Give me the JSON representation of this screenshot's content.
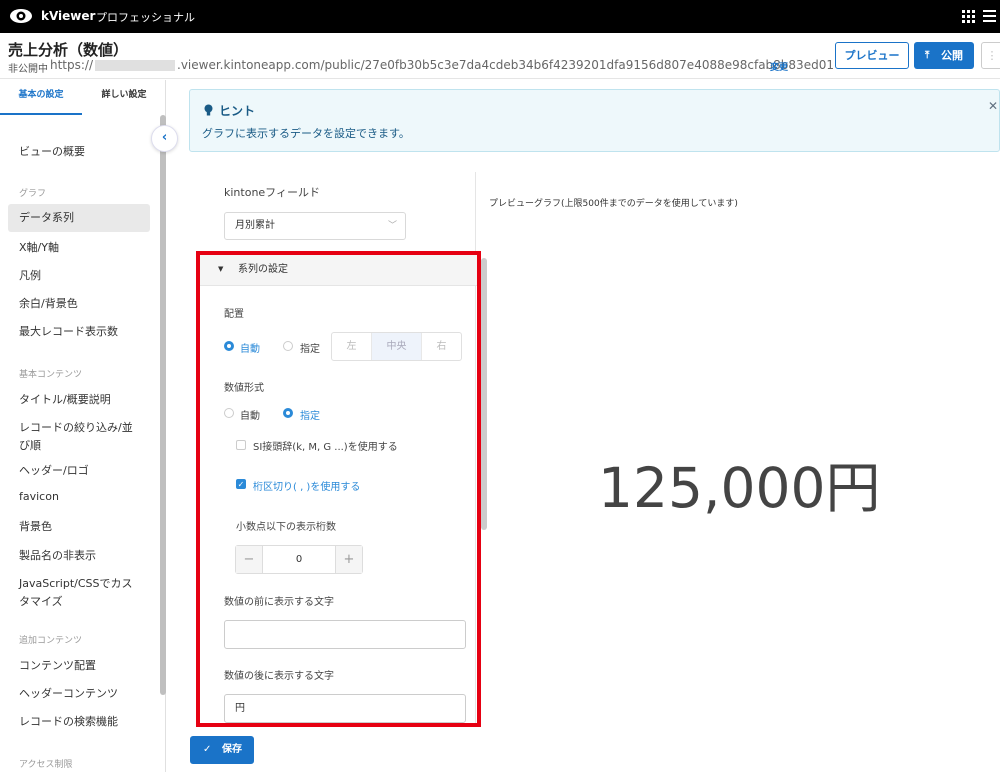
{
  "app": {
    "brand": "kViewer",
    "edition": "プロフェッショナル"
  },
  "header": {
    "title": "売上分析（数値）",
    "status": "非公開中",
    "url_prefix": "https://",
    "url_suffix": ".viewer.kintoneapp.com/public/27e0fb30b5c3e7da4cdeb34b6f4239201dfa9156d807e4088e98cfab8b83ed01",
    "change_label": "変更",
    "preview_button": "プレビュー",
    "publish_button": "公開"
  },
  "sidebar": {
    "tabs": [
      "基本の設定",
      "詳しい設定"
    ],
    "items": {
      "overview": "ビューの概要",
      "graph_section": "グラフ",
      "data_series": "データ系列",
      "axis": "X軸/Y軸",
      "legend": "凡例",
      "margin_bg": "余白/背景色",
      "max_records": "最大レコード表示数",
      "basic_content_section": "基本コンテンツ",
      "title_desc": "タイトル/概要説明",
      "filter_sort_1": "レコードの絞り込み/並",
      "filter_sort_2": "び順",
      "header_logo": "ヘッダー/ロゴ",
      "favicon": "favicon",
      "bg_color": "背景色",
      "hide_product": "製品名の非表示",
      "js_css_1": "JavaScript/CSSでカス",
      "js_css_2": "タマイズ",
      "extra_section": "追加コンテンツ",
      "content_layout": "コンテンツ配置",
      "header_content": "ヘッダーコンテンツ",
      "record_search": "レコードの検索機能",
      "access_section": "アクセス制限"
    }
  },
  "hint": {
    "title": "ヒント",
    "description": "グラフに表示するデータを設定できます。"
  },
  "form": {
    "kintone_field_label": "kintoneフィールド",
    "kintone_field_value": "月別累計",
    "series_settings": "系列の設定",
    "placement_label": "配置",
    "placement_auto": "自動",
    "placement_manual": "指定",
    "align_left": "左",
    "align_center": "中央",
    "align_right": "右",
    "number_format_label": "数値形式",
    "format_auto": "自動",
    "format_manual": "指定",
    "si_prefix": "SI接頭辞(k, M, G ...)を使用する",
    "thousands_sep": "桁区切り( , )を使用する",
    "decimal_label": "小数点以下の表示桁数",
    "decimal_value": "0",
    "prefix_label": "数値の前に表示する文字",
    "prefix_value": "",
    "suffix_label": "数値の後に表示する文字",
    "suffix_value": "円",
    "save_button": "保存"
  },
  "preview": {
    "label": "プレビューグラフ(上限500件までのデータを使用しています)",
    "value": "125,000円"
  },
  "colors": {
    "accent": "#1a73c8",
    "highlight_border": "#e60012",
    "topbar": "#000000"
  }
}
